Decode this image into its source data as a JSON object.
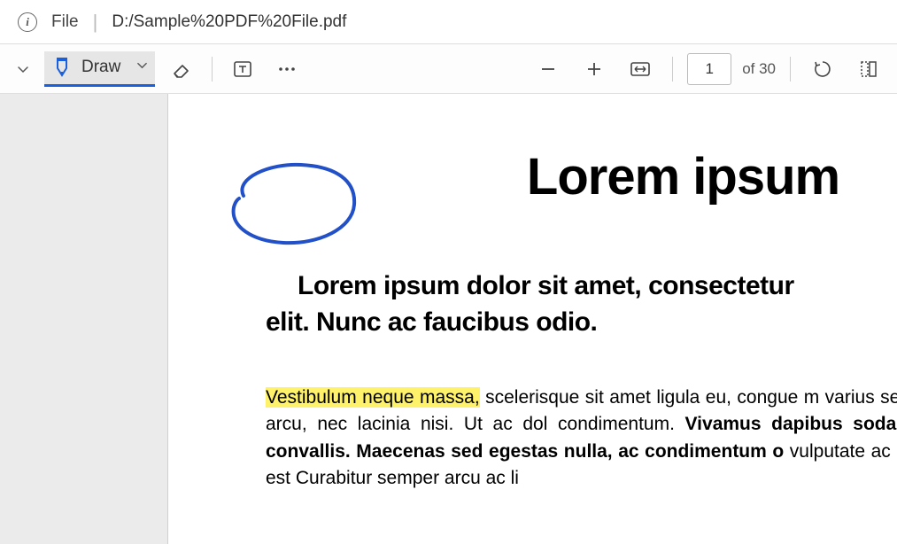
{
  "address": {
    "file_label": "File",
    "path": "D:/Sample%20PDF%20File.pdf"
  },
  "toolbar": {
    "draw_label": "Draw",
    "page_current": "1",
    "page_total": "of 30"
  },
  "document": {
    "title": "Lorem ipsum",
    "subheading": "Lorem ipsum dolor sit amet, consectetur\nelit. Nunc ac faucibus odio.",
    "body_highlighted": "Vestibulum neque massa,",
    "body_rest": " scelerisque sit amet ligula eu, congue m varius sem. Nullam at porttitor arcu, nec lacinia nisi. Ut ac dol condimentum. ",
    "body_bold": "Vivamus dapibus sodales ex, vitae males convallis. Maecenas sed egestas nulla, ac condimentum o",
    "body_trail": " vulputate ac suscipit et  iaculis non est  Curabitur semper arcu ac li"
  },
  "colors": {
    "draw_accent": "#1a5fdb",
    "highlight": "#fff26b"
  }
}
